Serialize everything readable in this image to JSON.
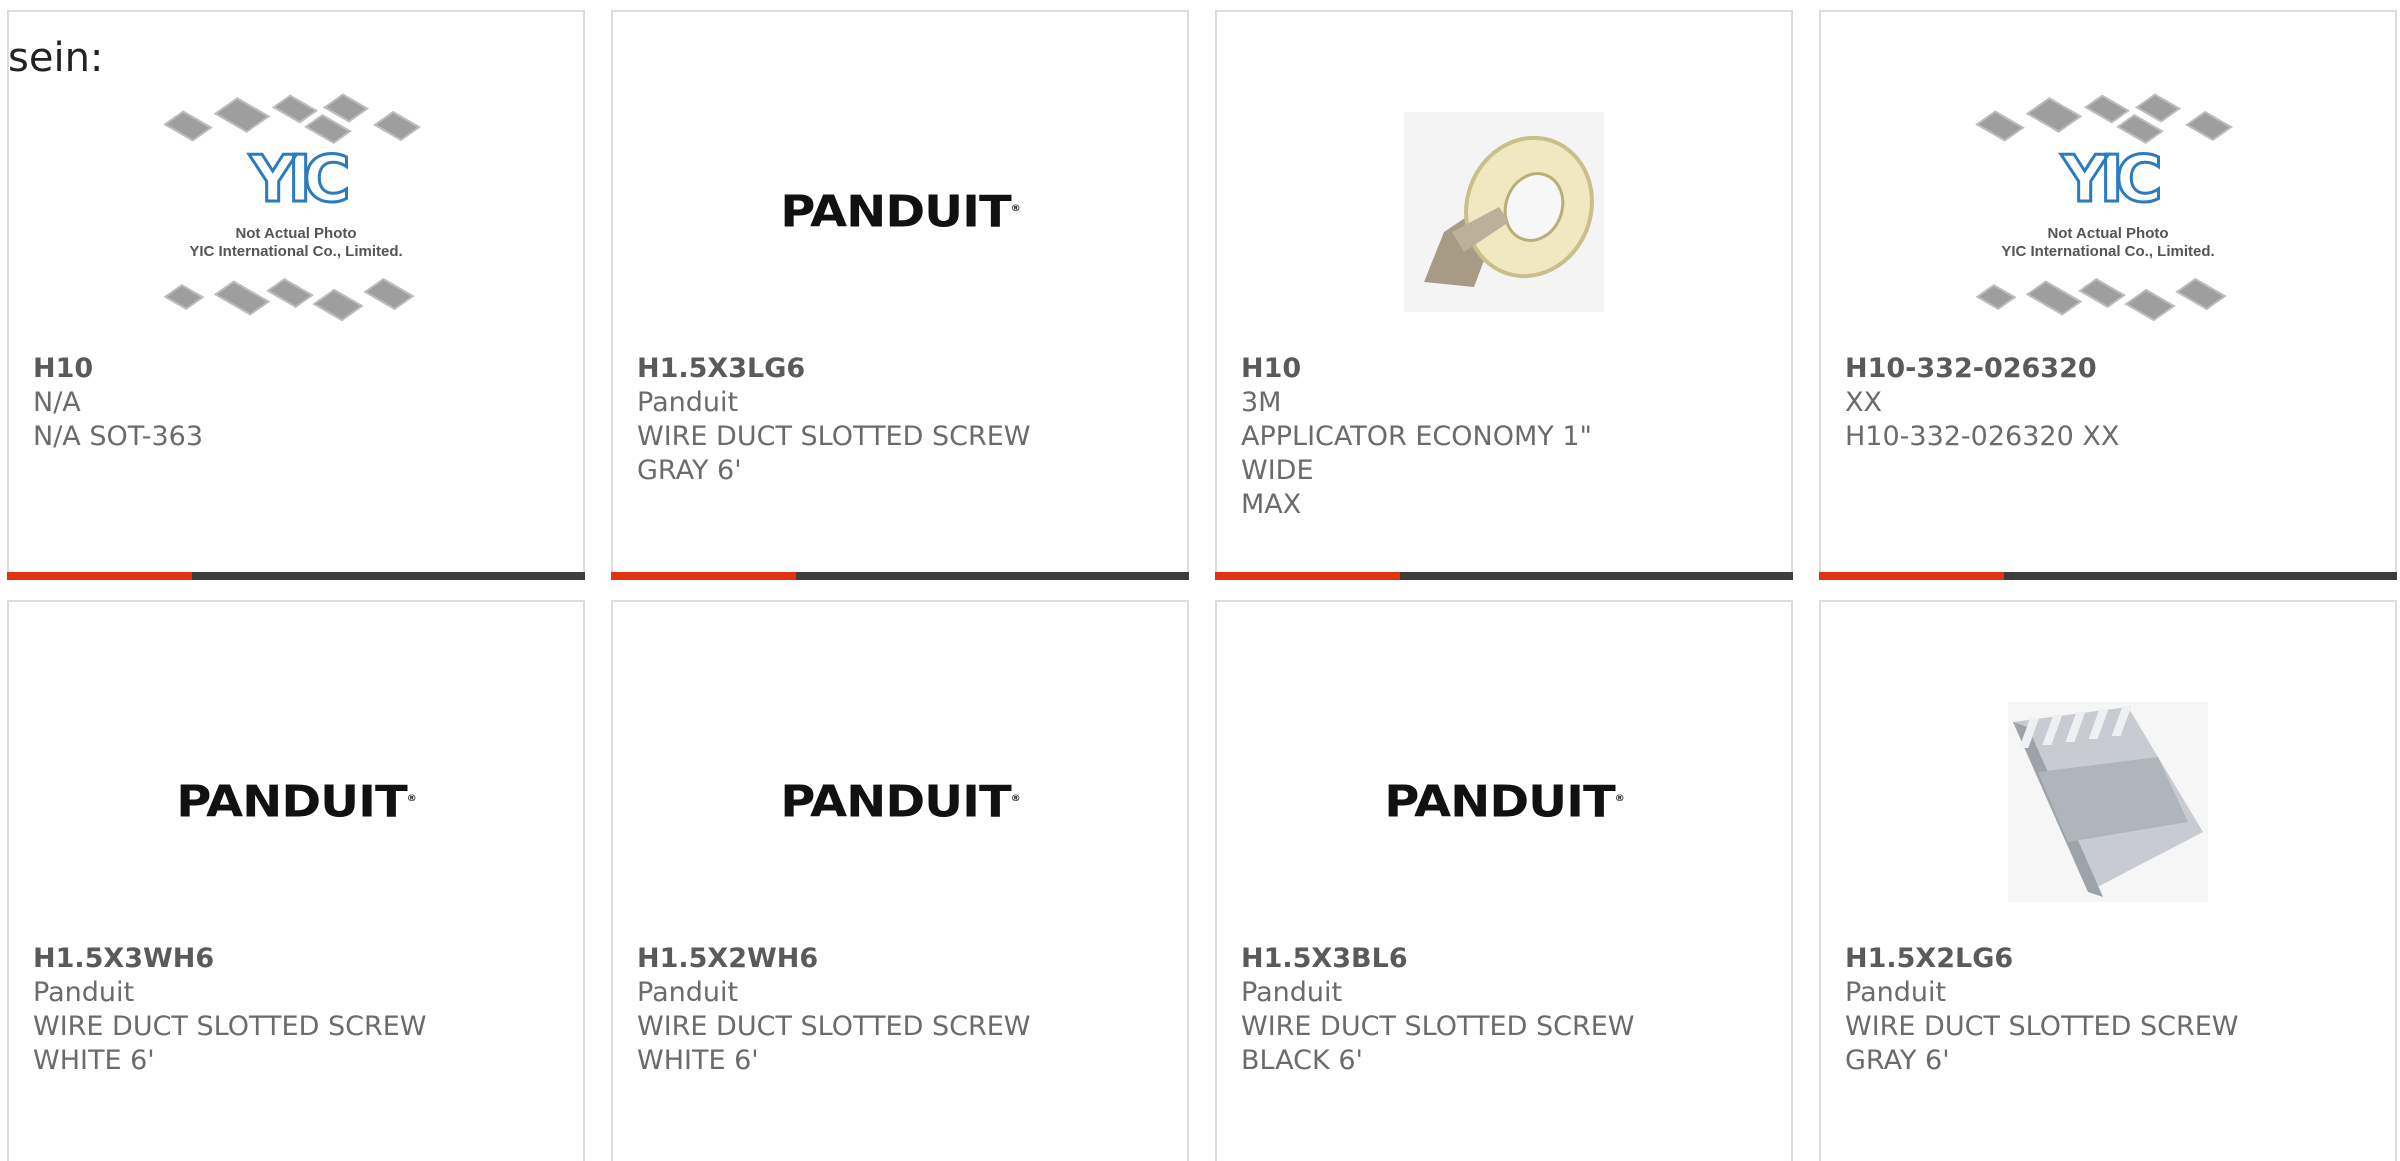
{
  "top_text": "sein:",
  "progress_color": "#e2330f",
  "products": [
    {
      "image": "yic-placeholder",
      "part": "H10",
      "manufacturer": "N/A",
      "description_1": "N/A SOT-363",
      "description_2": "",
      "progress": 0.32
    },
    {
      "image": "panduit-logo",
      "part": "H1.5X3LG6",
      "manufacturer": "Panduit",
      "description_1": "WIRE DUCT SLOTTED SCREW",
      "description_2": "GRAY 6'",
      "progress": 0.32
    },
    {
      "image": "tape-dispenser",
      "part": "H10",
      "manufacturer": "3M",
      "description_1": "APPLICATOR ECONOMY 1\" WIDE",
      "description_2": "MAX",
      "progress": 0.32
    },
    {
      "image": "yic-placeholder",
      "part": "H10-332-026320",
      "manufacturer": "XX",
      "description_1": "H10-332-026320 XX",
      "description_2": "",
      "progress": 0.32
    },
    {
      "image": "panduit-logo",
      "part": "H1.5X3WH6",
      "manufacturer": "Panduit",
      "description_1": "WIRE DUCT SLOTTED SCREW",
      "description_2": "WHITE 6'"
    },
    {
      "image": "panduit-logo",
      "part": "H1.5X2WH6",
      "manufacturer": "Panduit",
      "description_1": "WIRE DUCT SLOTTED SCREW",
      "description_2": "WHITE 6'"
    },
    {
      "image": "panduit-logo",
      "part": "H1.5X3BL6",
      "manufacturer": "Panduit",
      "description_1": "WIRE DUCT SLOTTED SCREW",
      "description_2": "BLACK 6'"
    },
    {
      "image": "wire-duct-photo",
      "part": "H1.5X2LG6",
      "manufacturer": "Panduit",
      "description_1": "WIRE DUCT SLOTTED SCREW",
      "description_2": "GRAY 6'"
    }
  ],
  "yic_placeholder": {
    "logo_text": "YIC",
    "line1": "Not Actual Photo",
    "line2": "YIC International Co., Limited."
  },
  "panduit_logo_text": "PANDUIT"
}
